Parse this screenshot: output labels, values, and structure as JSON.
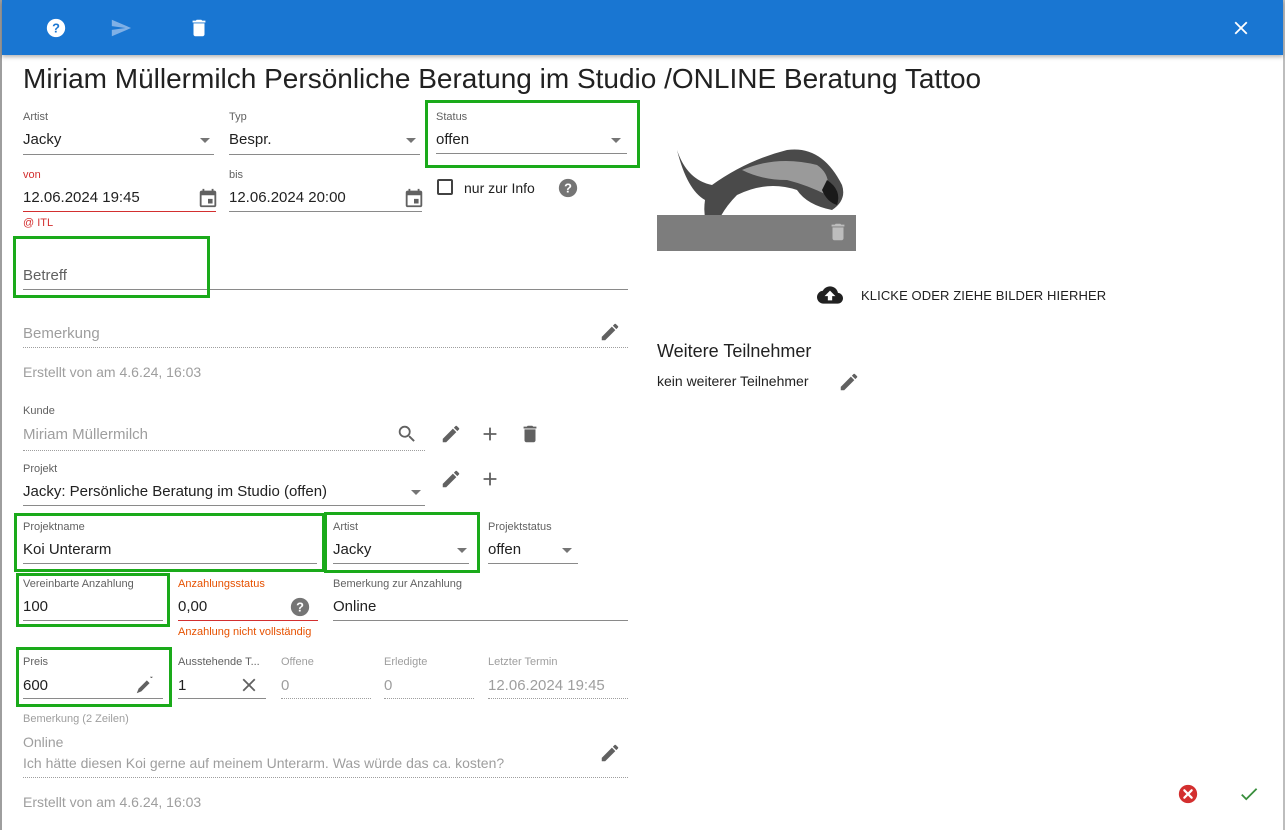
{
  "toolbar": {
    "icons": [
      "help-icon",
      "send-icon",
      "delete-icon",
      "close-icon"
    ],
    "color": "#1976d2"
  },
  "title": "Miriam Müllermilch Persönliche Beratung im Studio /ONLINE Beratung Tattoo",
  "appointment": {
    "artist": {
      "label": "Artist",
      "value": "Jacky"
    },
    "typ": {
      "label": "Typ",
      "value": "Bespr."
    },
    "status": {
      "label": "Status",
      "value": "offen"
    },
    "von": {
      "label": "von",
      "value": "12.06.2024 19:45",
      "helper": "@ ITL"
    },
    "bis": {
      "label": "bis",
      "value": "12.06.2024 20:00"
    },
    "nur_zur_info": {
      "label": "nur zur Info",
      "checked": false
    },
    "betreff": {
      "placeholder": "Betreff",
      "value": ""
    },
    "bemerkung": {
      "placeholder": "Bemerkung",
      "value": ""
    },
    "created": "Erstellt von am 4.6.24, 16:03"
  },
  "customer": {
    "kunde": {
      "label": "Kunde",
      "value": "Miriam Müllermilch"
    },
    "projekt": {
      "label": "Projekt",
      "value": "Jacky: Persönliche Beratung im Studio (offen)"
    }
  },
  "project": {
    "projektname": {
      "label": "Projektname",
      "value": "Koi Unterarm"
    },
    "artist": {
      "label": "Artist",
      "value": "Jacky"
    },
    "projektstatus": {
      "label": "Projektstatus",
      "value": "offen"
    },
    "vereinbarte_anzahlung": {
      "label": "Vereinbarte Anzahlung",
      "value": "100"
    },
    "anzahlungsstatus": {
      "label": "Anzahlungsstatus",
      "value": "0,00",
      "helper": "Anzahlung nicht vollständig"
    },
    "bemerkung_anzahlung": {
      "label": "Bemerkung zur Anzahlung",
      "value": "Online"
    },
    "preis": {
      "label": "Preis",
      "value": "600"
    },
    "ausstehende": {
      "label": "Ausstehende T...",
      "value": "1"
    },
    "offene": {
      "label": "Offene",
      "value": "0"
    },
    "erledigte": {
      "label": "Erledigte",
      "value": "0"
    },
    "letzter_termin": {
      "label": "Letzter Termin",
      "value": "12.06.2024 19:45"
    },
    "bemerkung2": {
      "label": "Bemerkung (2 Zeilen)",
      "line1": "Online",
      "line2": "Ich hätte diesen Koi gerne auf meinem Unterarm. Was würde das ca. kosten?"
    },
    "created": "Erstellt von am 4.6.24, 16:03"
  },
  "right": {
    "upload_label": "KLICKE ODER ZIEHE BILDER HIERHER",
    "participants_title": "Weitere Teilnehmer",
    "participants_value": "kein weiterer Teilnehmer"
  },
  "colors": {
    "highlight": "#1aaa1a",
    "error": "#d32f2f",
    "warning": "#e65100",
    "confirm": "#388e3c"
  }
}
